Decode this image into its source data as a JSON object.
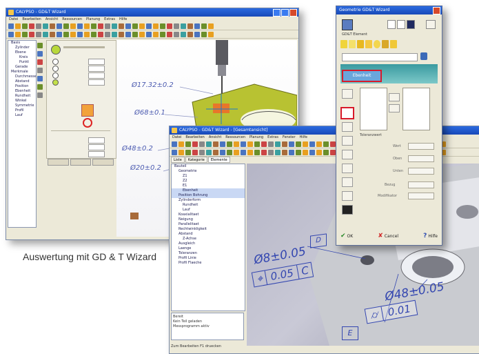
{
  "caption": "Auswertung mit GD & T Wizard",
  "back_window": {
    "title": "CALYPSO - GD&T Wizard",
    "menu": [
      "Datei",
      "Bearbeiten",
      "Ansicht",
      "Ressourcen",
      "Planung",
      "Extras",
      "Hilfe"
    ],
    "tree": [
      {
        "label": "Basis",
        "level": 1
      },
      {
        "label": "Zylinder",
        "level": 2
      },
      {
        "label": "Ebene",
        "level": 2
      },
      {
        "label": "Kreis",
        "level": 3
      },
      {
        "label": "Punkt",
        "level": 3
      },
      {
        "label": "Gerade",
        "level": 2
      },
      {
        "label": "Merkmale",
        "level": 1
      },
      {
        "label": "Durchmesser",
        "level": 2
      },
      {
        "label": "Abstand",
        "level": 2
      },
      {
        "label": "Position",
        "level": 2
      },
      {
        "label": "Ebenheit",
        "level": 2
      },
      {
        "label": "Rundheit",
        "level": 2
      },
      {
        "label": "Winkel",
        "level": 2
      },
      {
        "label": "Symmetrie",
        "level": 2
      },
      {
        "label": "Profil",
        "level": 2
      },
      {
        "label": "Lauf",
        "level": 2
      }
    ],
    "dims": [
      "Ø17.32±0.2",
      "Ø68±0.1",
      "Ø48±0.2",
      "Ø20±0.2"
    ]
  },
  "front_window": {
    "title": "CALYPSO - GD&T Wizard - [Gesamtansicht]",
    "menu": [
      "Datei",
      "Bearbeiten",
      "Ansicht",
      "Ressourcen",
      "Planung",
      "Extras",
      "Fenster",
      "Hilfe"
    ],
    "tabs": [
      "Liste",
      "Kategorie",
      "Elemente"
    ],
    "tree": [
      {
        "label": "Bauteil",
        "level": 1
      },
      {
        "label": "Geometrie",
        "level": 2
      },
      {
        "label": "Z1",
        "level": 3
      },
      {
        "label": "Z2",
        "level": 3
      },
      {
        "label": "E1",
        "level": 3
      },
      {
        "label": "Ebenheit",
        "level": 3,
        "selected": true
      },
      {
        "label": "Position Bohrung",
        "level": 2,
        "selected": true
      },
      {
        "label": "Zylinderform",
        "level": 2
      },
      {
        "label": "Rundheit",
        "level": 3
      },
      {
        "label": "Lauf",
        "level": 3
      },
      {
        "label": "Koaxialitaet",
        "level": 2
      },
      {
        "label": "Neigung",
        "level": 2
      },
      {
        "label": "Parallelitaet",
        "level": 2
      },
      {
        "label": "Rechtwinkligkeit",
        "level": 2
      },
      {
        "label": "Abstand",
        "level": 2
      },
      {
        "label": "Z-Achse",
        "level": 3
      },
      {
        "label": "Ausgleich",
        "level": 2
      },
      {
        "label": "Laenge",
        "level": 2
      },
      {
        "label": "Toleranzen",
        "level": 2
      },
      {
        "label": "Profil Linie",
        "level": 2
      },
      {
        "label": "Profil Flaeche",
        "level": 2
      }
    ],
    "status_lines": [
      "Bereit",
      "Kein Teil geladen",
      "Messprogramm aktiv"
    ],
    "status_bar": "Zum Bearbeiten F1 druecken",
    "gdt": {
      "datum_top": "D",
      "dim_left": "Ø8±0.05",
      "fcf_left_symbol": "⌖",
      "fcf_left_tol": "0.05",
      "fcf_left_datum": "C",
      "dim_right": "Ø48±0.05",
      "fcf_right_symbol": "⌭",
      "fcf_right_tol": "0.01",
      "datum_bottom": "E"
    }
  },
  "dialog": {
    "title": "Geometrie GD&T Wizard",
    "section_label": "GD&T Element",
    "highlight_label": "Ebenheit",
    "tolerance_heading": "Toleranzwert",
    "field_labels": [
      "Wert",
      "Oben",
      "Unten",
      "Bezug",
      "Modifikator"
    ],
    "footer": {
      "ok": "OK",
      "cancel": "Cancel",
      "help": "Hilfe"
    }
  }
}
